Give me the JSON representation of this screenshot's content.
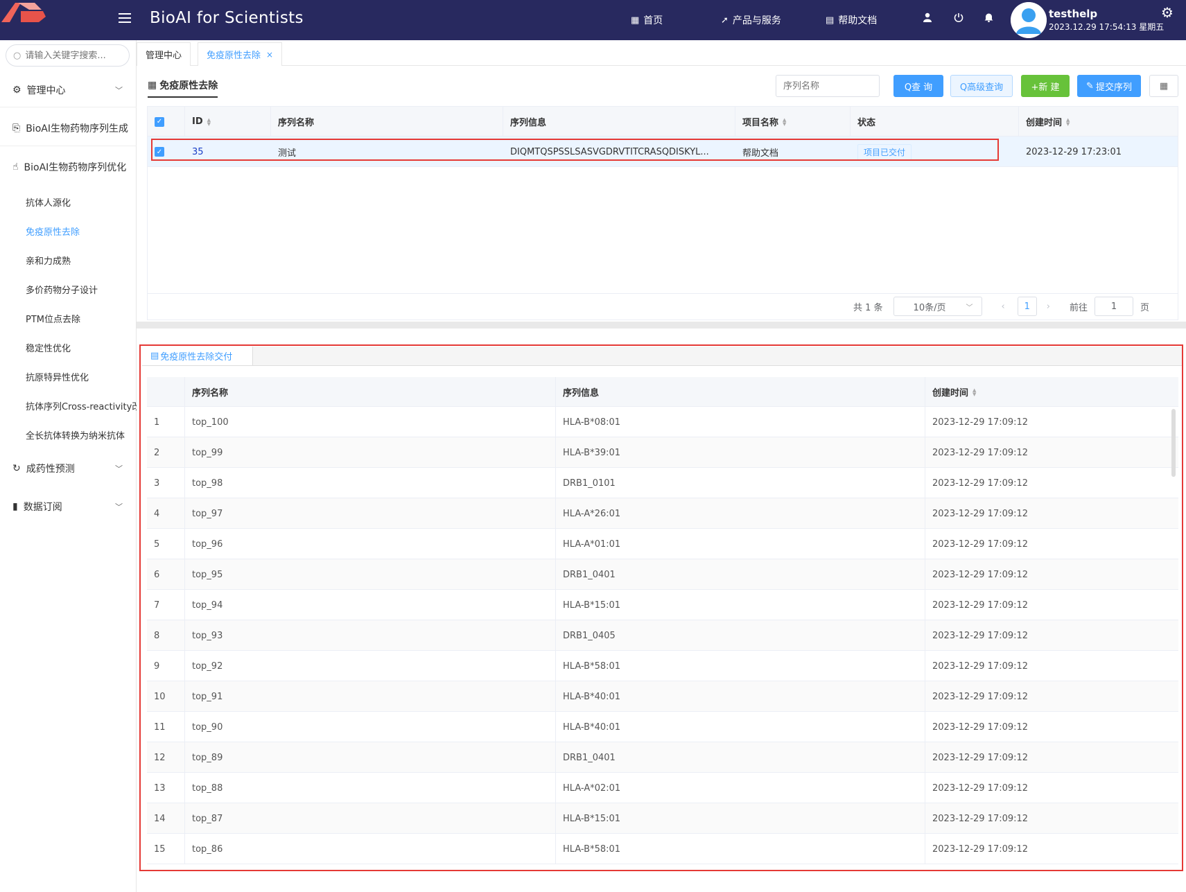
{
  "header": {
    "app_title": "BioAI for Scientists",
    "nav": [
      {
        "label": "首页",
        "icon": "grid-icon"
      },
      {
        "label": "产品与服务",
        "icon": "send-icon"
      },
      {
        "label": "帮助文档",
        "icon": "doc-icon"
      }
    ],
    "user": {
      "name": "testhelp",
      "datetime": "2023.12.29 17:54:13 星期五"
    }
  },
  "sidebar": {
    "search_placeholder": "请输入关键字搜索...",
    "groups": [
      {
        "label": "管理中心",
        "icon": "gear-icon",
        "has_chevron": true
      },
      {
        "label": "BioAI生物药物序列生成",
        "icon": "clipboard-icon",
        "has_chevron": false
      },
      {
        "label": "BioAI生物药物序列优化",
        "icon": "hand-icon",
        "has_chevron": false
      }
    ],
    "subitems": [
      {
        "label": "抗体人源化",
        "active": false
      },
      {
        "label": "免疫原性去除",
        "active": true
      },
      {
        "label": "亲和力成熟",
        "active": false
      },
      {
        "label": "多价药物分子设计",
        "active": false
      },
      {
        "label": "PTM位点去除",
        "active": false
      },
      {
        "label": "稳定性优化",
        "active": false
      },
      {
        "label": "抗原特异性优化",
        "active": false
      },
      {
        "label": "抗体序列Cross-reactivity改",
        "active": false
      },
      {
        "label": "全长抗体转换为纳米抗体",
        "active": false
      }
    ],
    "groups_bottom": [
      {
        "label": "成药性预测",
        "icon": "refresh-icon"
      },
      {
        "label": "数据订阅",
        "icon": "bar-chart-icon"
      }
    ]
  },
  "tabs": [
    {
      "label": "管理中心",
      "active": false
    },
    {
      "label": "免疫原性去除",
      "active": true,
      "close": "×"
    }
  ],
  "upper": {
    "title": "免疫原性去除",
    "filter_placeholder": "序列名称",
    "buttons": {
      "query": "Q查 询",
      "advanced": "Q高级查询",
      "new": "+新 建",
      "submit": "提交序列"
    },
    "columns": [
      "ID",
      "序列名称",
      "序列信息",
      "项目名称",
      "状态",
      "创建时间"
    ],
    "rows": [
      {
        "id": "35",
        "name": "测试",
        "seq": "DIQMTQSPSSLSASVGDRVTITCRASQDISKYL...",
        "project": "帮助文档",
        "status": "项目已交付",
        "created": "2023-12-29 17:23:01"
      }
    ],
    "pager": {
      "total": "共 1 条",
      "page_size": "10条/页",
      "current": "1",
      "goto_label": "前往",
      "goto_value": "1",
      "page_suffix": "页"
    }
  },
  "lower": {
    "tab_label": "免疫原性去除交付",
    "columns": [
      "序列名称",
      "序列信息",
      "创建时间"
    ],
    "rows": [
      {
        "n": "1",
        "name": "top_100",
        "seq": "HLA-B*08:01",
        "created": "2023-12-29 17:09:12"
      },
      {
        "n": "2",
        "name": "top_99",
        "seq": "HLA-B*39:01",
        "created": "2023-12-29 17:09:12"
      },
      {
        "n": "3",
        "name": "top_98",
        "seq": "DRB1_0101",
        "created": "2023-12-29 17:09:12"
      },
      {
        "n": "4",
        "name": "top_97",
        "seq": "HLA-A*26:01",
        "created": "2023-12-29 17:09:12"
      },
      {
        "n": "5",
        "name": "top_96",
        "seq": "HLA-A*01:01",
        "created": "2023-12-29 17:09:12"
      },
      {
        "n": "6",
        "name": "top_95",
        "seq": "DRB1_0401",
        "created": "2023-12-29 17:09:12"
      },
      {
        "n": "7",
        "name": "top_94",
        "seq": "HLA-B*15:01",
        "created": "2023-12-29 17:09:12"
      },
      {
        "n": "8",
        "name": "top_93",
        "seq": "DRB1_0405",
        "created": "2023-12-29 17:09:12"
      },
      {
        "n": "9",
        "name": "top_92",
        "seq": "HLA-B*58:01",
        "created": "2023-12-29 17:09:12"
      },
      {
        "n": "10",
        "name": "top_91",
        "seq": "HLA-B*40:01",
        "created": "2023-12-29 17:09:12"
      },
      {
        "n": "11",
        "name": "top_90",
        "seq": "HLA-B*40:01",
        "created": "2023-12-29 17:09:12"
      },
      {
        "n": "12",
        "name": "top_89",
        "seq": "DRB1_0401",
        "created": "2023-12-29 17:09:12"
      },
      {
        "n": "13",
        "name": "top_88",
        "seq": "HLA-A*02:01",
        "created": "2023-12-29 17:09:12"
      },
      {
        "n": "14",
        "name": "top_87",
        "seq": "HLA-B*15:01",
        "created": "2023-12-29 17:09:12"
      },
      {
        "n": "15",
        "name": "top_86",
        "seq": "HLA-B*58:01",
        "created": "2023-12-29 17:09:12"
      }
    ]
  },
  "colors": {
    "topbar": "#28295f",
    "accent": "#409eff",
    "green": "#67c23a",
    "highlight": "#e53935"
  }
}
